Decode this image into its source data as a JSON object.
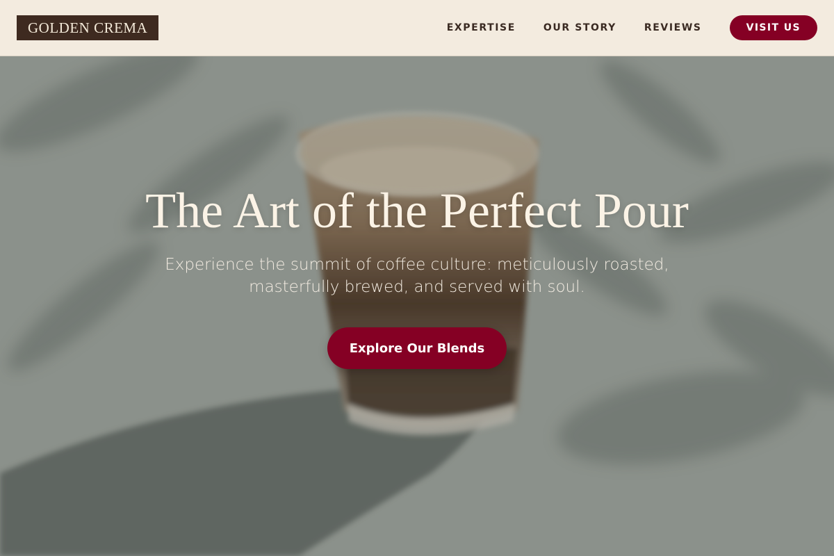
{
  "header": {
    "logo": "GOLDEN CREMA",
    "nav": [
      {
        "label": "EXPERTISE"
      },
      {
        "label": "OUR STORY"
      },
      {
        "label": "REVIEWS"
      }
    ],
    "cta_label": "VISIT US"
  },
  "hero": {
    "title": "The Art of the Perfect Pour",
    "subtitle": "Experience the summit of coffee culture: meticulously roasted, masterfully brewed, and served with soul.",
    "cta_label": "Explore Our Blends"
  },
  "colors": {
    "header_bg": "#f3ebdf",
    "logo_bg": "#3e2a20",
    "accent": "#850024",
    "hero_text": "#fbf3e6"
  },
  "icons": {
    "hero_image": "coffee-glass-photo"
  }
}
